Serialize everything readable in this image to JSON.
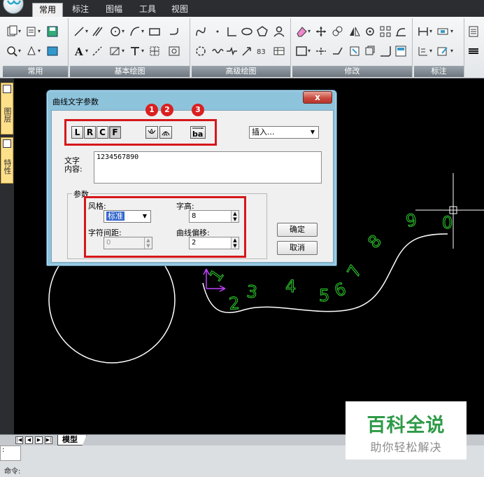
{
  "ribbon": {
    "tabs": [
      "常用",
      "标注",
      "图幅",
      "工具",
      "视图"
    ],
    "active_tab": "常用",
    "groups": [
      "常用",
      "基本绘图",
      "高级绘图",
      "修改",
      "标注"
    ]
  },
  "left_panel": {
    "tab1": "图层",
    "tab2": "特性"
  },
  "dialog": {
    "title": "曲线文字参数",
    "close_label": "x",
    "align_buttons": [
      "L",
      "R",
      "C",
      "F"
    ],
    "badges": [
      "1",
      "2",
      "3"
    ],
    "insert_mode": "插入...",
    "text_label": "文字\n内容:",
    "text_value": "1234567890",
    "params_label": "参数",
    "style_label": "风格:",
    "style_value": "标准",
    "height_label": "字高:",
    "height_value": "8",
    "spacing_label": "字符间距:",
    "spacing_value": "0",
    "offset_label": "曲线偏移:",
    "offset_value": "2",
    "ok_label": "确定",
    "cancel_label": "取消",
    "reverse_icon_text": "ba"
  },
  "canvas": {
    "curve_text": [
      "1",
      "2",
      "3",
      "4",
      "5",
      "6",
      "7",
      "8",
      "9",
      "0"
    ],
    "text_color": "#2fd12f",
    "line_color": "#ffffff",
    "ucs_color": "#c040ff"
  },
  "layout": {
    "model_tab": "模型"
  },
  "command": {
    "prompt": "命令:",
    "history": ":"
  },
  "watermark": {
    "title": "百科全说",
    "subtitle": "助你轻松解决"
  }
}
